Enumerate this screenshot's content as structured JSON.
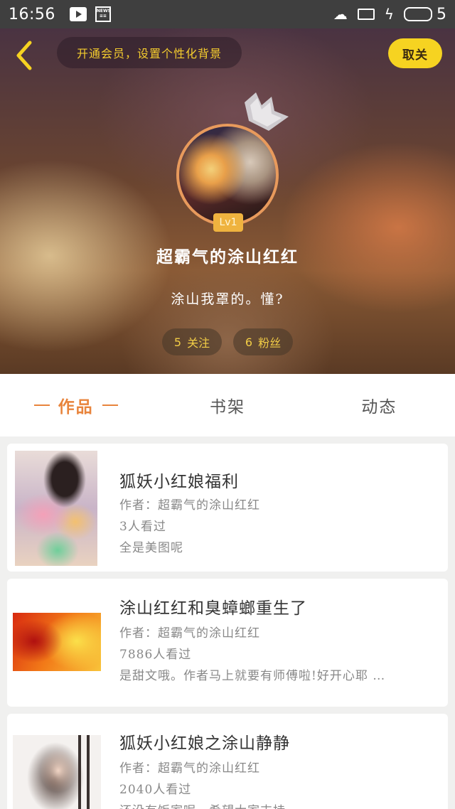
{
  "status_bar": {
    "time": "16:56",
    "battery_level": "5",
    "icons": [
      "play-icon",
      "news-icon",
      "sleep-notification-icon",
      "tablet-icon",
      "charging-icon",
      "battery-icon"
    ]
  },
  "header": {
    "vip_text": "开通会员，设置个性化背景",
    "unfollow_label": "取关",
    "level": "Lv1",
    "username": "超霸气的涂山红红",
    "bio": "涂山我罩的。懂?",
    "follow_count": "5",
    "follow_label": "关注",
    "fans_count": "6",
    "fans_label": "粉丝"
  },
  "tabs": [
    {
      "label": "作品",
      "active": true
    },
    {
      "label": "书架",
      "active": false
    },
    {
      "label": "动态",
      "active": false
    }
  ],
  "works": [
    {
      "title": "狐妖小红娘福利",
      "author": "作者：超霸气的涂山红红",
      "views": "3人看过",
      "desc": "全是美图呢"
    },
    {
      "title": "涂山红红和臭蟑螂重生了",
      "author": "作者：超霸气的涂山红红",
      "views": "7886人看过",
      "desc": "是甜文哦。作者马上就要有师傅啦!好开心耶 …"
    },
    {
      "title": "狐妖小红娘之涂山静静",
      "author": "作者：超霸气的涂山红红",
      "views": "2040人看过",
      "desc": "还没有饭家呢，希望大家支持"
    }
  ],
  "colors": {
    "accent": "#e8843c",
    "vip_text": "#f5cd2e",
    "unfollow_bg": "#f6d321",
    "level_badge": "#efb33f"
  }
}
